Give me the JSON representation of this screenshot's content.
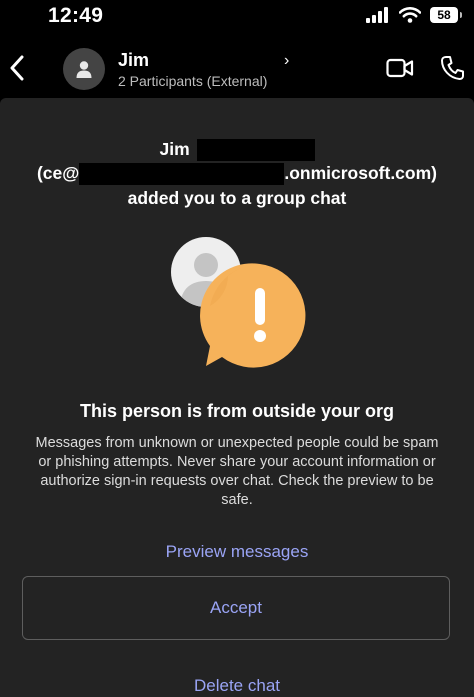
{
  "status_bar": {
    "time": "12:49",
    "battery": "58"
  },
  "header": {
    "name": "Jim",
    "chevron": "›",
    "subtitle": "2 Participants (External)"
  },
  "notice": {
    "name": "Jim",
    "email_prefix": "(ce@",
    "email_suffix": ".onmicrosoft.com)",
    "added_text": "added you to a group chat"
  },
  "warning": {
    "title": "This person is from outside your org",
    "body": "Messages from unknown or unexpected people could be spam or phishing attempts. Never share your account information or authorize sign-in requests over chat. Check the preview to be safe."
  },
  "actions": {
    "preview_label": "Preview messages",
    "accept_label": "Accept",
    "delete_label": "Delete chat"
  },
  "colors": {
    "accent": "#9aa4f5",
    "alert_orange": "#f6b25a",
    "sheet_bg": "#232323"
  },
  "icons": {
    "back": "chevron-left-icon",
    "avatar": "person-icon",
    "video": "video-camera-icon",
    "phone": "phone-icon",
    "illustration": "external-user-alert-icon"
  }
}
